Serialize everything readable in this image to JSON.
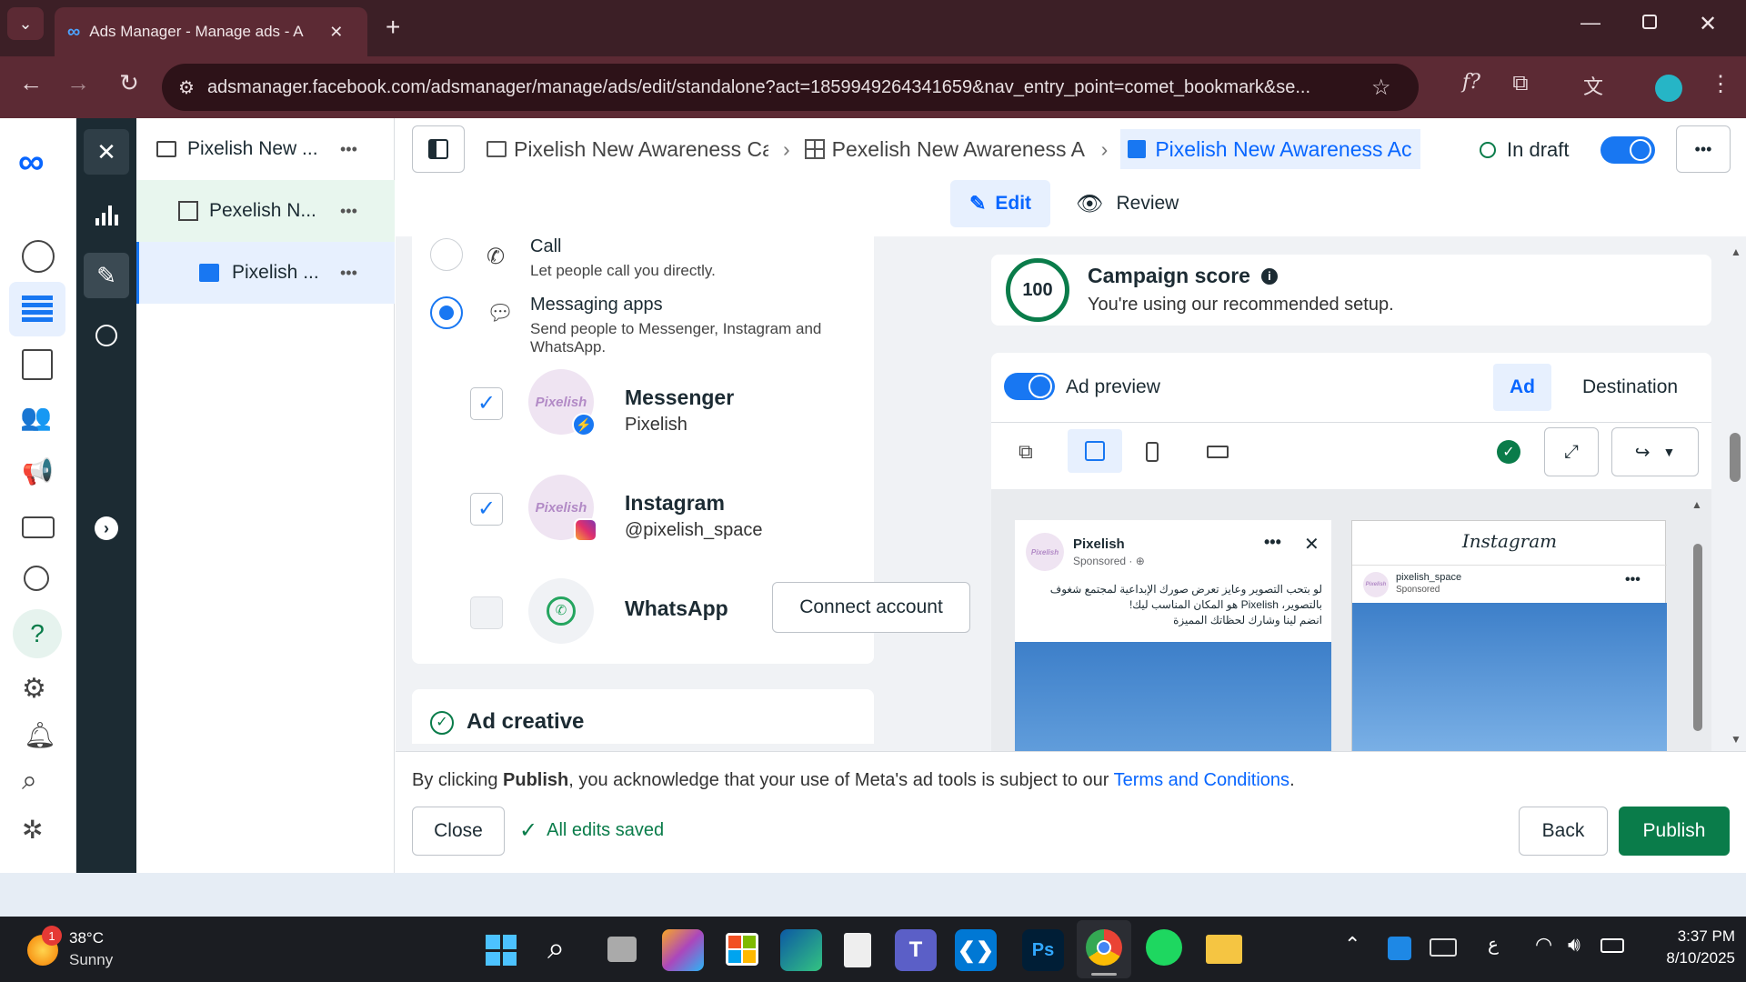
{
  "browser": {
    "tab_title": "Ads Manager - Manage ads - A",
    "url": "adsmanager.facebook.com/adsmanager/manage/ads/edit/standalone?act=1859949264341659&nav_entry_point=comet_bookmark&se...",
    "profile_color": "#26b5c6"
  },
  "tree": {
    "items": [
      {
        "label": "Pixelish New ...",
        "more": "•••"
      },
      {
        "label": "Pexelish N...",
        "more": "•••"
      },
      {
        "label": "Pixelish ...",
        "more": "•••"
      }
    ]
  },
  "header": {
    "breadcrumbs": [
      "Pixelish New Awareness Ca",
      "Pexelish New Awareness A",
      "Pixelish New Awareness Ac"
    ],
    "status": "In draft",
    "more": "•••"
  },
  "modes": {
    "edit": "Edit",
    "review": "Review"
  },
  "destination": {
    "call_title": "Call",
    "call_desc": "Let people call you directly.",
    "msg_title": "Messaging apps",
    "msg_desc": "Send people to Messenger, Instagram and WhatsApp.",
    "apps": [
      {
        "name": "Messenger",
        "account": "Pixelish",
        "checked": true
      },
      {
        "name": "Instagram",
        "account": "@pixelish_space",
        "checked": true
      },
      {
        "name": "WhatsApp",
        "account": "",
        "checked": false
      }
    ],
    "connect_label": "Connect account",
    "avatar_text": "Pixelish"
  },
  "creative": {
    "title": "Ad creative"
  },
  "score": {
    "value": "100",
    "title": "Campaign score",
    "desc": "You're using our recommended setup."
  },
  "preview": {
    "toggle_label": "Ad preview",
    "tab_ad": "Ad",
    "tab_destination": "Destination",
    "fb_page": "Pixelish",
    "fb_sponsored": "Sponsored · ",
    "fb_text_1": "لو بتحب التصوير وعايز تعرض صورك الإبداعية لمجتمع شغوف",
    "fb_text_2": "بالتصوير، Pixelish هو المكان المناسب ليك!",
    "fb_text_3": "انضم لينا وشارك لحظاتك المميزة",
    "ig_logo": "Instagram",
    "ig_user": "pixelish_space",
    "ig_sponsored": "Sponsored"
  },
  "footer": {
    "notice_prefix": "By clicking ",
    "notice_bold": "Publish",
    "notice_mid": ", you acknowledge that your use of Meta's ad tools is subject to our ",
    "notice_link": "Terms and Conditions",
    "notice_end": ".",
    "close": "Close",
    "saved": "All edits saved",
    "back": "Back",
    "publish": "Publish"
  },
  "taskbar": {
    "temp": "38°C",
    "weather": "Sunny",
    "badge": "1",
    "time": "3:37 PM",
    "date": "8/10/2025",
    "lang": "ع",
    "ps_label": "Ps"
  },
  "colors": {
    "accent": "#1877f2",
    "publish": "#0a7c4a",
    "score": "#0a7c4a",
    "browser_tab": "#3c1f26",
    "browser_toolbar": "#5c2a34"
  }
}
